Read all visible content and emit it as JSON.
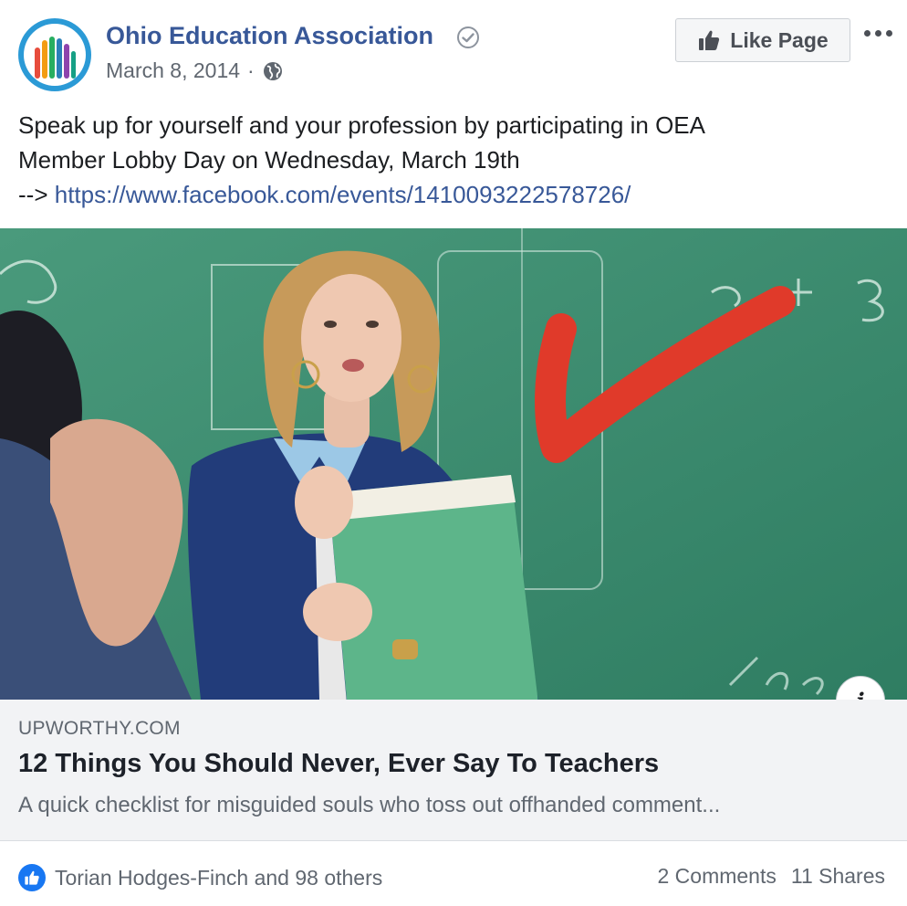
{
  "header": {
    "page_name": "Ohio Education Association",
    "date": "March 8, 2014",
    "separator": "·",
    "like_page_label": "Like Page"
  },
  "post": {
    "message_line1": "Speak up for yourself and your profession by participating in OEA",
    "message_line2": "Member Lobby Day on Wednesday, March 19th",
    "message_prefix": "-->",
    "message_link": "https://www.facebook.com/events/1410093222578726/"
  },
  "preview": {
    "domain": "UPWORTHY.COM",
    "title": "12 Things You Should Never, Ever Say To Teachers",
    "description": "A quick checklist for misguided souls who toss out offhanded comment...",
    "info_label": "i"
  },
  "footer": {
    "reactions_text": "Torian Hodges-Finch and 98 others",
    "comments": "2 Comments",
    "shares": "11 Shares"
  },
  "colors": {
    "link": "#385898",
    "accent": "#1877f2",
    "chalkboard": "#3f8f73",
    "check": "#e03a2a"
  },
  "icons": [
    "verified-badge-icon",
    "globe-icon",
    "thumbs-up-icon",
    "more-options-icon",
    "info-icon",
    "like-reaction-icon"
  ]
}
